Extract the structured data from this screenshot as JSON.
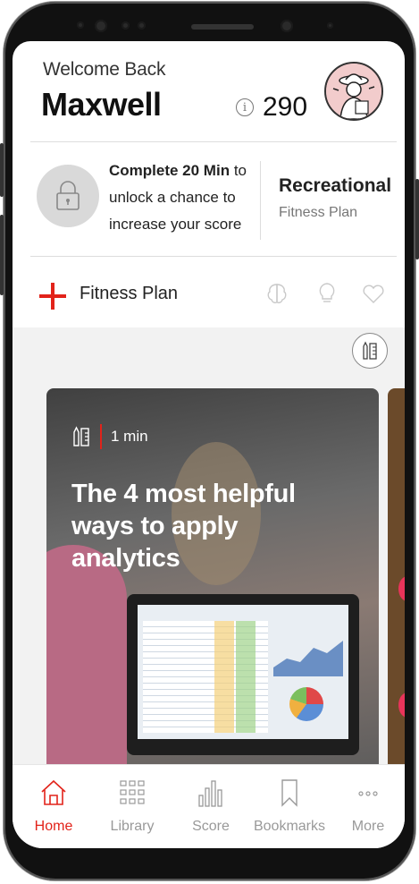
{
  "header": {
    "welcome": "Welcome Back",
    "username": "Maxwell",
    "score": "290",
    "info_icon": "i"
  },
  "unlock_card": {
    "bold": "Complete 20 Min",
    "rest_1": " to",
    "line_2": "unlock a chance to",
    "line_3": "increase your score",
    "plan_title": "Recreational",
    "plan_subtitle": "Fitness Plan"
  },
  "fitness_row": {
    "label": "Fitness Plan",
    "icons": [
      "brain-icon",
      "lightbulb-icon",
      "heart-icon"
    ]
  },
  "feed": {
    "card": {
      "duration": "1 min",
      "title": "The 4 most helpful ways to apply analytics"
    }
  },
  "nav": {
    "items": [
      {
        "label": "Home",
        "icon": "home-icon",
        "active": true
      },
      {
        "label": "Library",
        "icon": "grid-icon",
        "active": false
      },
      {
        "label": "Score",
        "icon": "bar-chart-icon",
        "active": false
      },
      {
        "label": "Bookmarks",
        "icon": "bookmark-icon",
        "active": false
      },
      {
        "label": "More",
        "icon": "more-icon",
        "active": false
      }
    ]
  },
  "colors": {
    "accent": "#e2231a",
    "muted": "#999999"
  }
}
